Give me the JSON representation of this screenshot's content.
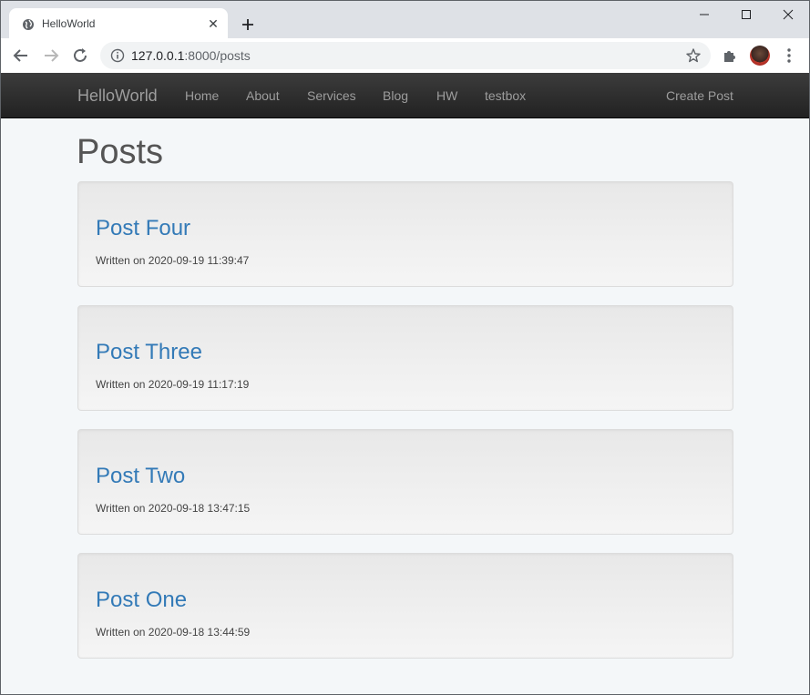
{
  "browser": {
    "tab_title": "HelloWorld",
    "tab_close": "✕",
    "url_host": "127.0.0.1",
    "url_rest": ":8000/posts"
  },
  "navbar": {
    "brand": "HelloWorld",
    "links": [
      "Home",
      "About",
      "Services",
      "Blog",
      "HW",
      "testbox"
    ],
    "create_post": "Create Post"
  },
  "main": {
    "heading": "Posts",
    "posts": [
      {
        "title": "Post Four",
        "meta": "Written on 2020-09-19 11:39:47"
      },
      {
        "title": "Post Three",
        "meta": "Written on 2020-09-19 11:17:19"
      },
      {
        "title": "Post Two",
        "meta": "Written on 2020-09-18 13:47:15"
      },
      {
        "title": "Post One",
        "meta": "Written on 2020-09-18 13:44:59"
      }
    ]
  },
  "colors": {
    "link": "#337ab7",
    "navbar": "#222222",
    "background": "#f4f7f9"
  }
}
